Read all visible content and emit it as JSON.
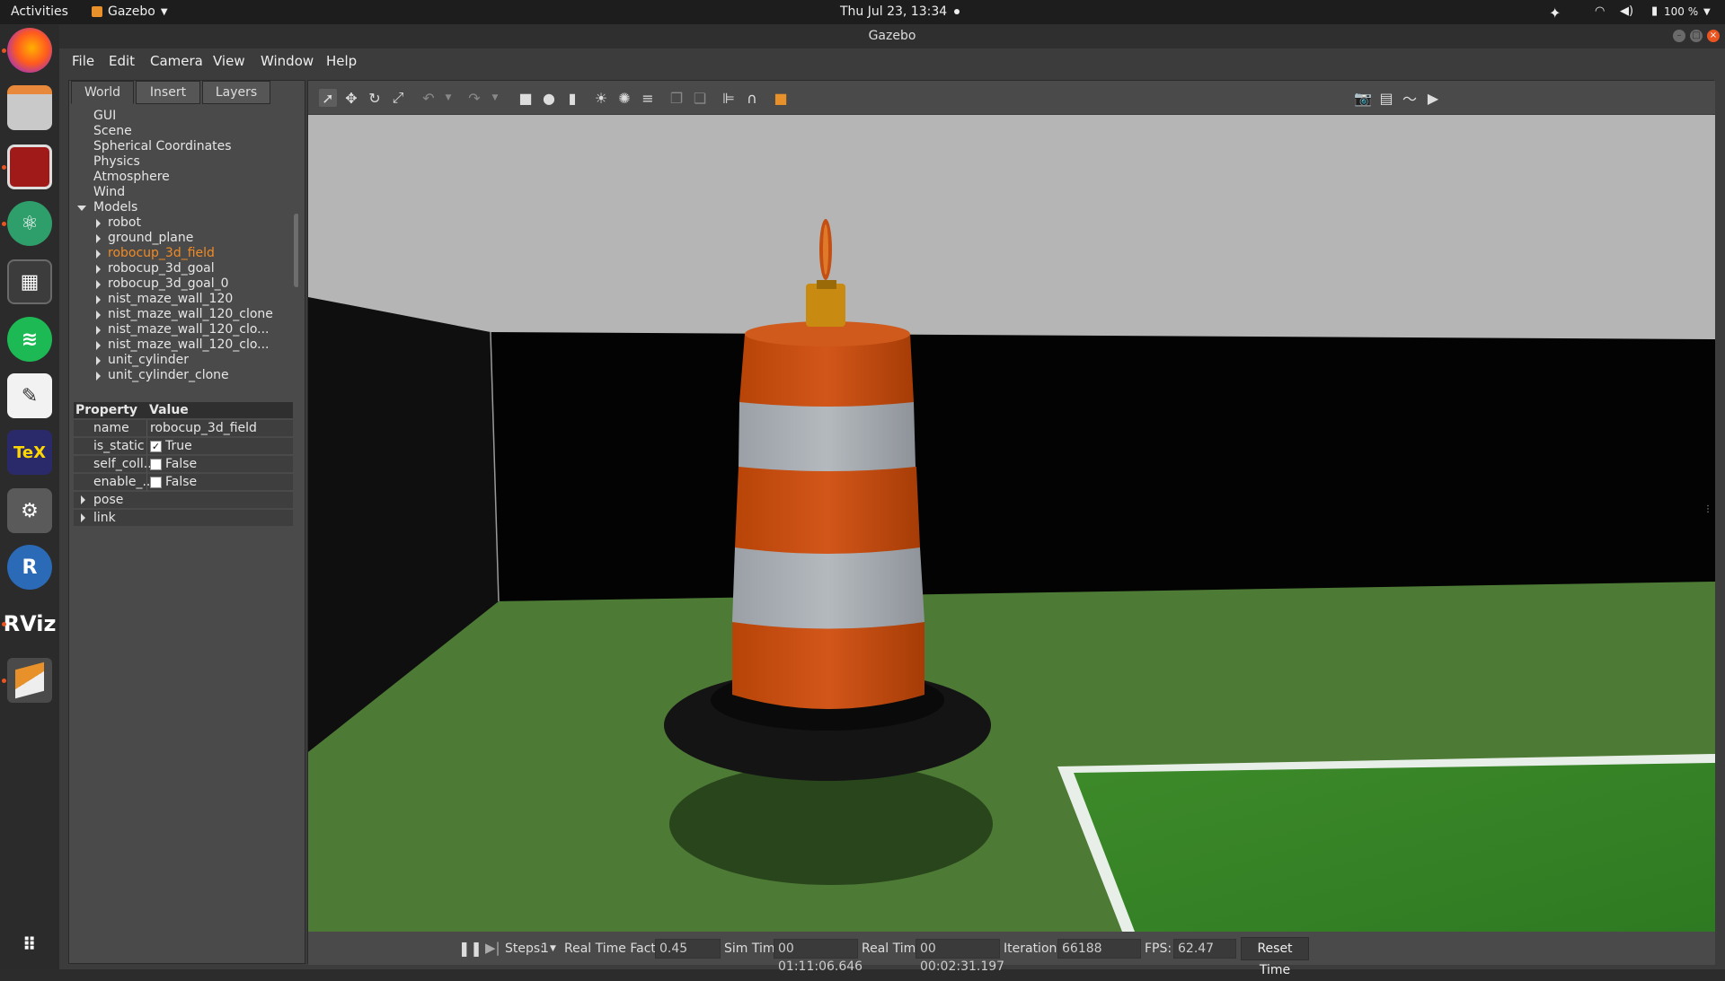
{
  "topbar": {
    "activities": "Activities",
    "app_name": "Gazebo",
    "clock": "Thu Jul 23, 13:34",
    "battery": "100 %"
  },
  "window": {
    "title": "Gazebo"
  },
  "menu": [
    "File",
    "Edit",
    "Camera",
    "View",
    "Window",
    "Help"
  ],
  "left_tabs": [
    "World",
    "Insert",
    "Layers"
  ],
  "tree": {
    "top_items": [
      "GUI",
      "Scene",
      "Spherical Coordinates",
      "Physics",
      "Atmosphere",
      "Wind",
      "Models"
    ],
    "models": [
      "robot",
      "ground_plane",
      "robocup_3d_field",
      "robocup_3d_goal",
      "robocup_3d_goal_0",
      "nist_maze_wall_120",
      "nist_maze_wall_120_clone",
      "nist_maze_wall_120_clo...",
      "nist_maze_wall_120_clo...",
      "unit_cylinder",
      "unit_cylinder_clone"
    ],
    "selected_model": "robocup_3d_field"
  },
  "properties": {
    "header_property": "Property",
    "header_value": "Value",
    "rows": [
      {
        "key": "name",
        "value": "robocup_3d_field"
      },
      {
        "key": "is_static",
        "value": "True",
        "checked": true
      },
      {
        "key": "self_coll...",
        "value": "False",
        "checked": false
      },
      {
        "key": "enable_...",
        "value": "False",
        "checked": false
      }
    ],
    "groups": [
      "pose",
      "link"
    ]
  },
  "bottom": {
    "steps_label": "Steps:",
    "steps_value": "1",
    "rtf_label": "Real Time Factor:",
    "rtf_value": "0.45",
    "sim_label": "Sim Time:",
    "sim_value": "00 01:11:06.646",
    "real_label": "Real Time:",
    "real_value": "00 00:02:31.197",
    "iter_label": "Iterations:",
    "iter_value": "66188",
    "fps_label": "FPS:",
    "fps_value": "62.47",
    "reset_label": "Reset Time"
  },
  "colors": {
    "accent_orange": "#e95420",
    "selected_text": "#f08a24",
    "sky": "#b5b5b5",
    "ground": "#4d7a35",
    "barrel_orange": "#c44f12"
  }
}
